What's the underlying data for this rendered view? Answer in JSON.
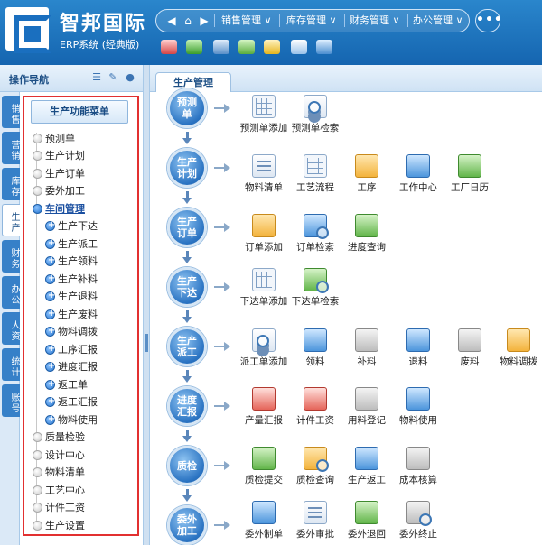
{
  "header": {
    "brand": "智邦国际",
    "subtitle": "ERP系统 (经典版)",
    "home_icon": "home-icon",
    "nav": [
      {
        "label": "销售管理 ∨"
      },
      {
        "label": "库存管理 ∨"
      },
      {
        "label": "财务管理 ∨"
      },
      {
        "label": "办公管理 ∨"
      }
    ],
    "more_label": "•••",
    "quick_icons": [
      "megaphone-icon",
      "phone-icon",
      "folder-icon",
      "mail-icon",
      "wechat-icon",
      "apps-icon",
      "book-icon"
    ]
  },
  "left_nav": {
    "title": "操作导航",
    "icons": [
      "list-icon",
      "pin-icon",
      "user-icon"
    ],
    "side_tabs": [
      "销售",
      "营销",
      "库存",
      "生产",
      "财务",
      "办公",
      "人资",
      "统计",
      "账号"
    ],
    "active_side_tab": "生产",
    "menu_title": "生产功能菜单",
    "items": [
      {
        "label": "预测单"
      },
      {
        "label": "生产计划"
      },
      {
        "label": "生产订单"
      },
      {
        "label": "委外加工"
      },
      {
        "label": "车间管理"
      },
      {
        "label": "生产下达"
      },
      {
        "label": "生产派工"
      },
      {
        "label": "生产领料"
      },
      {
        "label": "生产补料"
      },
      {
        "label": "生产退料"
      },
      {
        "label": "生产废料"
      },
      {
        "label": "物料调拨"
      },
      {
        "label": "工序汇报"
      },
      {
        "label": "进度汇报"
      },
      {
        "label": "返工单"
      },
      {
        "label": "返工汇报"
      },
      {
        "label": "物料使用"
      },
      {
        "label": "质量检验"
      },
      {
        "label": "设计中心"
      },
      {
        "label": "物料清单"
      },
      {
        "label": "工艺中心"
      },
      {
        "label": "计件工资"
      },
      {
        "label": "生产设置"
      }
    ]
  },
  "content": {
    "tab_label": "生产管理",
    "stages": [
      {
        "label": "预测单",
        "functions": [
          "预测单添加",
          "预测单检索"
        ]
      },
      {
        "label": "生产计划",
        "functions": [
          "物料清单",
          "工艺流程",
          "工序",
          "工作中心",
          "工厂日历"
        ]
      },
      {
        "label": "生产订单",
        "functions": [
          "订单添加",
          "订单检索",
          "进度查询"
        ]
      },
      {
        "label": "生产下达",
        "functions": [
          "下达单添加",
          "下达单检索"
        ]
      },
      {
        "label": "生产派工",
        "functions": [
          "派工单添加",
          "领料",
          "补料",
          "退料",
          "废料",
          "物料调拨"
        ]
      },
      {
        "label": "进度汇报",
        "functions": [
          "产量汇报",
          "计件工资",
          "用料登记",
          "物料使用"
        ]
      },
      {
        "label": "质检",
        "functions": [
          "质检提交",
          "质检查询",
          "生产返工",
          "成本核算"
        ]
      },
      {
        "label": "委外加工",
        "functions": [
          "委外制单",
          "委外审批",
          "委外退回",
          "委外终止"
        ]
      }
    ]
  }
}
